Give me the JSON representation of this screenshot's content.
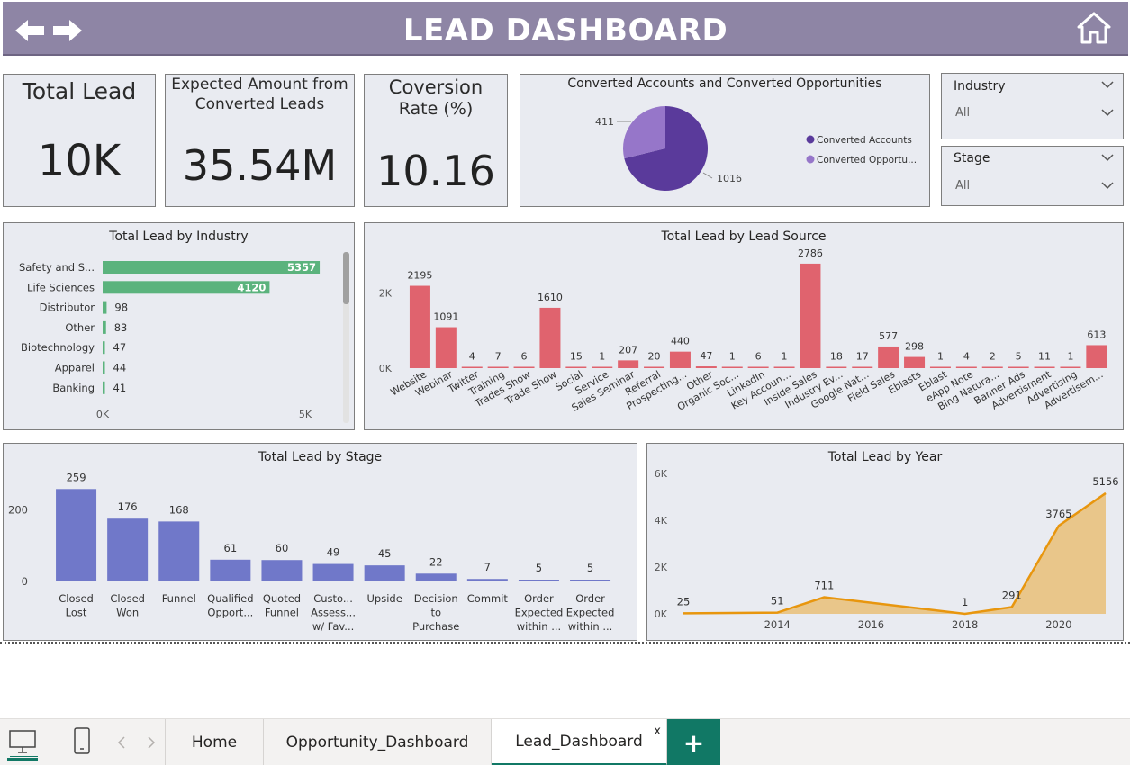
{
  "header": {
    "title": "LEAD DASHBOARD"
  },
  "kpis": {
    "total_lead": {
      "label": "Total Lead",
      "value": "10K"
    },
    "expected_amount": {
      "label_line1": "Expected Amount from",
      "label_line2": "Converted Leads",
      "value": "35.54M"
    },
    "conversion_rate": {
      "label_line1": "Coversion",
      "label_line2": "Rate (%)",
      "value": "10.16"
    }
  },
  "slicers": {
    "industry": {
      "label": "Industry",
      "value": "All"
    },
    "stage": {
      "label": "Stage",
      "value": "All"
    }
  },
  "colors": {
    "header": "#8e85a5",
    "industry_bar": "#5bb37d",
    "source_bar": "#e0636e",
    "stage_bar": "#7078c9",
    "year_line": "#e8960e",
    "year_area": "#e9c68a",
    "pie_accounts": "#5a3a9b",
    "pie_opps": "#9676c9",
    "tab_accent": "#117865"
  },
  "chart_data": [
    {
      "type": "pie",
      "title": "Converted Accounts and Converted Opportunities",
      "series": [
        {
          "name": "Converted Accounts",
          "value": 1016,
          "label": "1016"
        },
        {
          "name": "Converted Opportu...",
          "value": 411,
          "label": "411"
        }
      ]
    },
    {
      "type": "bar",
      "orientation": "horizontal",
      "title": "Total Lead by Industry",
      "categories": [
        "Safety and S...",
        "Life Sciences",
        "Distributor",
        "Other",
        "Biotechnology",
        "Apparel",
        "Banking"
      ],
      "values": [
        5357,
        4120,
        98,
        83,
        47,
        44,
        41
      ],
      "xlim": [
        0,
        6000
      ],
      "x_ticks": [
        "0K",
        "5K"
      ]
    },
    {
      "type": "bar",
      "title": "Total Lead by Lead Source",
      "categories": [
        "Website",
        "Webinar",
        "Twitter",
        "Training",
        "Trades Show",
        "Trade Show",
        "Social",
        "Service",
        "Sales Seminar",
        "Referral",
        "Prospecting...",
        "Other",
        "Organic Soc...",
        "LinkedIn",
        "Key Accoun...",
        "Inside Sales",
        "Industry Ev...",
        "Google Nat...",
        "Field Sales",
        "Eblasts",
        "Eblast",
        "eApp Note",
        "Bing Natura...",
        "Banner Ads",
        "Advertisment",
        "Advertising",
        "Advertisem..."
      ],
      "values": [
        2195,
        1091,
        4,
        7,
        6,
        1610,
        15,
        1,
        207,
        20,
        440,
        47,
        1,
        6,
        1,
        2786,
        18,
        17,
        577,
        298,
        1,
        4,
        2,
        5,
        11,
        1,
        613
      ],
      "ylim": [
        0,
        3000
      ],
      "y_ticks": [
        "0K",
        "2K"
      ]
    },
    {
      "type": "bar",
      "title": "Total Lead by Stage",
      "categories": [
        [
          "Closed",
          "Lost"
        ],
        [
          "Closed",
          "Won"
        ],
        [
          "Funnel"
        ],
        [
          "Qualified",
          "Opport..."
        ],
        [
          "Quoted",
          "Funnel"
        ],
        [
          "Custo...",
          "Assess...",
          "w/ Fav..."
        ],
        [
          "Upside"
        ],
        [
          "Decision",
          "to",
          "Purchase"
        ],
        [
          "Commit"
        ],
        [
          "Order",
          "Expected",
          "within ..."
        ],
        [
          "Order",
          "Expected",
          "within ..."
        ]
      ],
      "values": [
        259,
        176,
        168,
        61,
        60,
        49,
        45,
        22,
        7,
        5,
        5
      ],
      "ylim": [
        0,
        290
      ],
      "y_ticks": [
        "0",
        "200"
      ]
    },
    {
      "type": "area",
      "title": "Total Lead by Year",
      "x": [
        2012,
        2014,
        2015,
        2018,
        2019,
        2020,
        2021
      ],
      "values": [
        25,
        51,
        711,
        1,
        291,
        3765,
        5156
      ],
      "labels": [
        "25",
        "51",
        "711",
        "1",
        "291",
        "3765",
        "5156"
      ],
      "xlim": [
        2012,
        2021
      ],
      "ylim": [
        0,
        6000
      ],
      "x_ticks": [
        "2014",
        "2016",
        "2018",
        "2020"
      ],
      "y_ticks": [
        "0K",
        "2K",
        "4K",
        "6K"
      ]
    }
  ],
  "tabs": [
    {
      "label": "Home"
    },
    {
      "label": "Opportunity_Dashboard"
    },
    {
      "label": "Lead_Dashboard",
      "close": "x"
    }
  ],
  "add_tab": "+"
}
